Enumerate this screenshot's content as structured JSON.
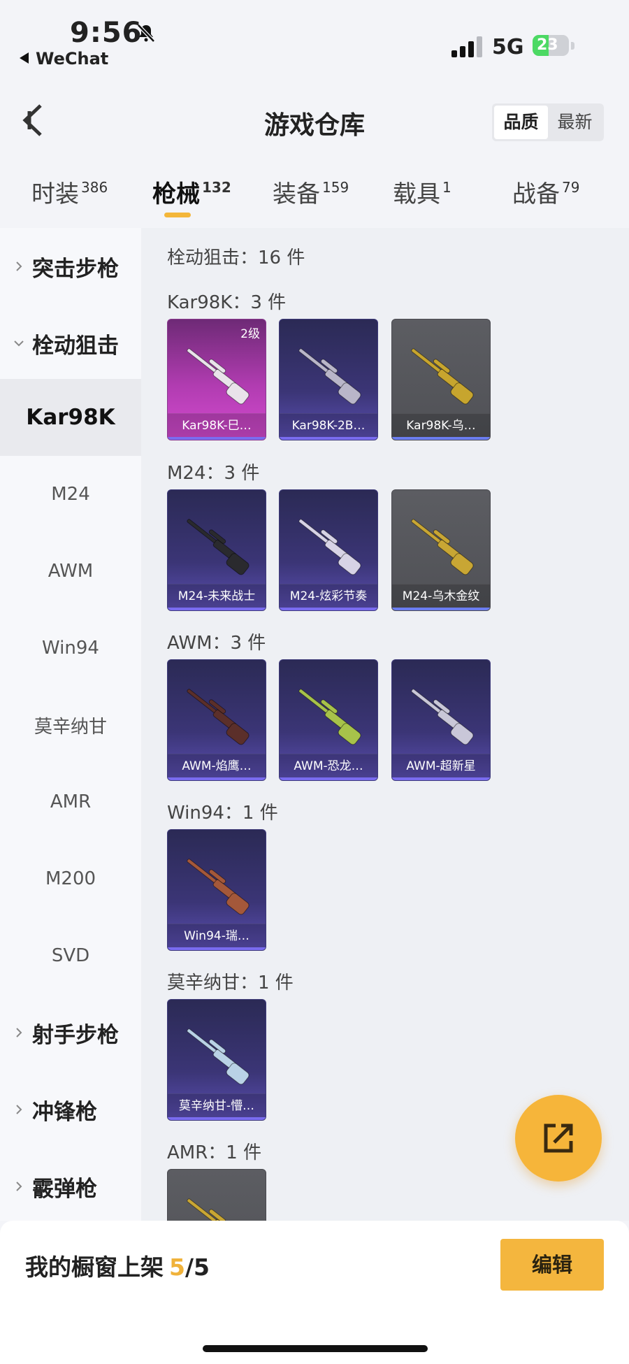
{
  "status_bar": {
    "time": "9:56",
    "back_app": "WeChat",
    "network": "5G",
    "battery": "23"
  },
  "nav": {
    "title": "游戏仓库",
    "sort_options": [
      "品质",
      "最新"
    ],
    "sort_selected": "品质"
  },
  "tabs": [
    {
      "label": "时装",
      "count": "386"
    },
    {
      "label": "枪械",
      "count": "132",
      "active": true
    },
    {
      "label": "装备",
      "count": "159"
    },
    {
      "label": "载具",
      "count": "1"
    },
    {
      "label": "战备",
      "count": "79"
    }
  ],
  "sidebar": {
    "items": [
      {
        "label": "突击步枪",
        "type": "group",
        "expanded": false
      },
      {
        "label": "栓动狙击",
        "type": "group",
        "expanded": true
      },
      {
        "label": "Kar98K",
        "type": "sub",
        "active": true
      },
      {
        "label": "M24",
        "type": "sub"
      },
      {
        "label": "AWM",
        "type": "sub"
      },
      {
        "label": "Win94",
        "type": "sub"
      },
      {
        "label": "莫辛纳甘",
        "type": "sub"
      },
      {
        "label": "AMR",
        "type": "sub"
      },
      {
        "label": "M200",
        "type": "sub"
      },
      {
        "label": "SVD",
        "type": "sub"
      },
      {
        "label": "射手步枪",
        "type": "group",
        "expanded": false
      },
      {
        "label": "冲锋枪",
        "type": "group",
        "expanded": false
      },
      {
        "label": "霰弹枪",
        "type": "group",
        "expanded": false
      }
    ]
  },
  "content": {
    "category_header": "栓动狙击：16 件",
    "sections": [
      {
        "header": "Kar98K：3 件",
        "items": [
          {
            "name": "Kar98K-巳…",
            "style": "pink",
            "level": "2级",
            "gun_color": "#e9e3ea"
          },
          {
            "name": "Kar98K-2B…",
            "style": "purple",
            "gun_color": "#b9b6c9"
          },
          {
            "name": "Kar98K-乌…",
            "style": "gray",
            "gun_color": "#c7a52e"
          }
        ]
      },
      {
        "header": "M24：3 件",
        "items": [
          {
            "name": "M24-未来战士",
            "style": "purple",
            "gun_color": "#2a2a2e"
          },
          {
            "name": "M24-炫彩节奏",
            "style": "purple",
            "gun_color": "#d7d3e6"
          },
          {
            "name": "M24-乌木金纹",
            "style": "gray",
            "gun_color": "#c8a634"
          }
        ]
      },
      {
        "header": "AWM：3 件",
        "items": [
          {
            "name": "AWM-焰鹰…",
            "style": "purple",
            "gun_color": "#5b2f2a"
          },
          {
            "name": "AWM-恐龙…",
            "style": "purple",
            "gun_color": "#a7c24a"
          },
          {
            "name": "AWM-超新星",
            "style": "purple",
            "gun_color": "#c9c7d8"
          }
        ]
      },
      {
        "header": "Win94：1 件",
        "items": [
          {
            "name": "Win94-瑞…",
            "style": "purple",
            "gun_color": "#a4583a"
          }
        ]
      },
      {
        "header": "莫辛纳甘：1 件",
        "items": [
          {
            "name": "莫辛纳甘-懵…",
            "style": "purple",
            "gun_color": "#b9d2e6"
          }
        ]
      },
      {
        "header": "AMR：1 件",
        "items": [
          {
            "name": "",
            "style": "gray",
            "gun_color": "#c8a634"
          }
        ]
      }
    ]
  },
  "bottom": {
    "showcase_label": "我的橱窗上架",
    "showcase_current": "5",
    "showcase_total": "/5",
    "edit_label": "编辑"
  },
  "colors": {
    "accent": "#f4b63e",
    "background": "#f3f4f8"
  }
}
